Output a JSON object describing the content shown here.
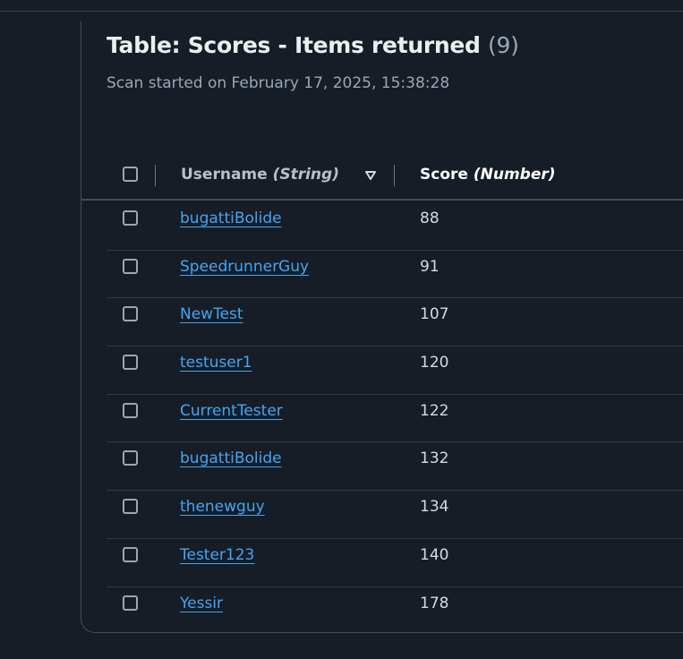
{
  "header": {
    "title": "Table: Scores - Items returned",
    "count": "(9)",
    "subtitle": "Scan started on February 17, 2025, 15:38:28"
  },
  "columns": {
    "username_name": "Username",
    "username_type": "(String)",
    "score_name": "Score",
    "score_type": "(Number)"
  },
  "icons": {
    "sort": "sort-descending-icon",
    "checkbox": "checkbox-icon"
  },
  "colors": {
    "link": "#42a5f5",
    "background": "#161d26"
  },
  "rows": [
    {
      "username": "bugattiBolide",
      "score": "88"
    },
    {
      "username": "SpeedrunnerGuy",
      "score": "91"
    },
    {
      "username": "NewTest",
      "score": "107"
    },
    {
      "username": "testuser1",
      "score": "120"
    },
    {
      "username": "CurrentTester",
      "score": "122"
    },
    {
      "username": "bugattiBolide",
      "score": "132"
    },
    {
      "username": "thenewguy",
      "score": "134"
    },
    {
      "username": "Tester123",
      "score": "140"
    },
    {
      "username": "Yessir",
      "score": "178"
    }
  ]
}
